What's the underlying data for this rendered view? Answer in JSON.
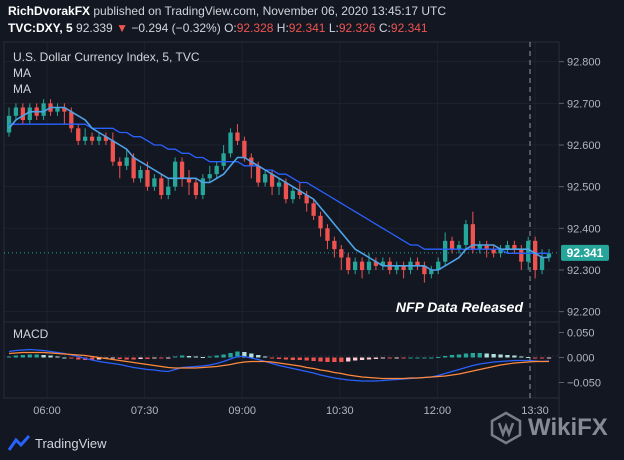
{
  "header": {
    "publisher": "RichDvorakFX",
    "published_text": "published on TradingView.com, November 06, 2020 13:45:17 UTC",
    "symbol": "TVC:DXY, 5",
    "price": "92.339",
    "change_arrow": "▼",
    "change": "−0.294 (−0.32%)",
    "o_label": "O:",
    "o_value": "92.328",
    "h_label": "H:",
    "h_value": "92.341",
    "l_label": "L:",
    "l_value": "92.326",
    "c_label": "C:",
    "c_value": "92.341"
  },
  "legend": {
    "series_title": "U.S. Dollar Currency Index, 5, TVC",
    "ma1": "MA",
    "ma2": "MA",
    "macd": "MACD"
  },
  "annotation": "NFP Data Released",
  "last_price_tag": "92.341",
  "branding": {
    "tradingview": "TradingView",
    "wikifx": "WikiFX"
  },
  "colors": {
    "background": "#131722",
    "up": "#26a69a",
    "down": "#ef5350",
    "ma_fast": "#4fa3e8",
    "ma_slow": "#2962ff",
    "macd_line": "#2962ff",
    "signal_line": "#ff8a3d",
    "price_tag": "#26a69a"
  },
  "chart_data": [
    {
      "type": "candlestick",
      "title": "U.S. Dollar Currency Index, 5, TVC",
      "x_ticks": [
        "06:00",
        "07:30",
        "09:00",
        "10:30",
        "12:00",
        "13:30"
      ],
      "y_ticks": [
        92.2,
        92.3,
        92.4,
        92.5,
        92.6,
        92.7,
        92.8
      ],
      "ylim": [
        92.18,
        92.84
      ],
      "candles": [
        [
          92.63,
          92.67,
          92.69,
          92.62
        ],
        [
          92.67,
          92.69,
          92.7,
          92.66
        ],
        [
          92.69,
          92.66,
          92.7,
          92.65
        ],
        [
          92.66,
          92.69,
          92.7,
          92.65
        ],
        [
          92.69,
          92.67,
          92.7,
          92.66
        ],
        [
          92.67,
          92.7,
          92.71,
          92.66
        ],
        [
          92.7,
          92.68,
          92.71,
          92.67
        ],
        [
          92.68,
          92.69,
          92.7,
          92.67
        ],
        [
          92.69,
          92.68,
          92.7,
          92.65
        ],
        [
          92.68,
          92.64,
          92.69,
          92.63
        ],
        [
          92.64,
          92.61,
          92.65,
          92.6
        ],
        [
          92.61,
          92.62,
          92.64,
          92.6
        ],
        [
          92.62,
          92.61,
          92.63,
          92.6
        ],
        [
          92.61,
          92.62,
          92.63,
          92.6
        ],
        [
          92.62,
          92.61,
          92.63,
          92.6
        ],
        [
          92.61,
          92.56,
          92.63,
          92.55
        ],
        [
          92.56,
          92.55,
          92.57,
          92.52
        ],
        [
          92.55,
          92.57,
          92.59,
          92.54
        ],
        [
          92.57,
          92.52,
          92.58,
          92.51
        ],
        [
          92.52,
          92.54,
          92.55,
          92.51
        ],
        [
          92.54,
          92.5,
          92.56,
          92.49
        ],
        [
          92.5,
          92.52,
          92.53,
          92.49
        ],
        [
          92.52,
          92.48,
          92.53,
          92.47
        ],
        [
          92.48,
          92.5,
          92.52,
          92.47
        ],
        [
          92.5,
          92.56,
          92.57,
          92.49
        ],
        [
          92.56,
          92.52,
          92.57,
          92.5
        ],
        [
          92.52,
          92.51,
          92.54,
          92.48
        ],
        [
          92.51,
          92.48,
          92.52,
          92.47
        ],
        [
          92.48,
          92.52,
          92.53,
          92.47
        ],
        [
          92.52,
          92.53,
          92.55,
          92.51
        ],
        [
          92.53,
          92.55,
          92.56,
          92.52
        ],
        [
          92.55,
          92.58,
          92.6,
          92.54
        ],
        [
          92.58,
          92.63,
          92.64,
          92.57
        ],
        [
          92.63,
          92.61,
          92.65,
          92.6
        ],
        [
          92.61,
          92.57,
          92.62,
          92.56
        ],
        [
          92.57,
          92.55,
          92.58,
          92.52
        ],
        [
          92.55,
          92.51,
          92.56,
          92.5
        ],
        [
          92.51,
          92.53,
          92.54,
          92.5
        ],
        [
          92.53,
          92.5,
          92.54,
          92.48
        ],
        [
          92.5,
          92.51,
          92.52,
          92.48
        ],
        [
          92.51,
          92.47,
          92.52,
          92.46
        ],
        [
          92.47,
          92.49,
          92.5,
          92.46
        ],
        [
          92.49,
          92.48,
          92.51,
          92.47
        ],
        [
          92.48,
          92.46,
          92.49,
          92.44
        ],
        [
          92.46,
          92.43,
          92.47,
          92.42
        ],
        [
          92.43,
          92.4,
          92.44,
          92.38
        ],
        [
          92.4,
          92.37,
          92.41,
          92.35
        ],
        [
          92.37,
          92.35,
          92.38,
          92.33
        ],
        [
          92.35,
          92.33,
          92.36,
          92.3
        ],
        [
          92.33,
          92.3,
          92.34,
          92.29
        ],
        [
          92.3,
          92.32,
          92.33,
          92.29
        ],
        [
          92.32,
          92.3,
          92.33,
          92.28
        ],
        [
          92.3,
          92.32,
          92.34,
          92.29
        ],
        [
          92.32,
          92.31,
          92.33,
          92.3
        ],
        [
          92.31,
          92.32,
          92.33,
          92.3
        ],
        [
          92.32,
          92.3,
          92.33,
          92.29
        ],
        [
          92.3,
          92.31,
          92.32,
          92.29
        ],
        [
          92.31,
          92.3,
          92.32,
          92.28
        ],
        [
          92.3,
          92.32,
          92.33,
          92.29
        ],
        [
          92.32,
          92.31,
          92.33,
          92.3
        ],
        [
          92.31,
          92.29,
          92.32,
          92.27
        ],
        [
          92.29,
          92.3,
          92.31,
          92.28
        ],
        [
          92.3,
          92.32,
          92.33,
          92.29
        ],
        [
          92.32,
          92.37,
          92.39,
          92.31
        ],
        [
          92.37,
          92.35,
          92.38,
          92.34
        ],
        [
          92.35,
          92.36,
          92.37,
          92.34
        ],
        [
          92.36,
          92.41,
          92.42,
          92.35
        ],
        [
          92.41,
          92.35,
          92.44,
          92.34
        ],
        [
          92.35,
          92.36,
          92.37,
          92.34
        ],
        [
          92.36,
          92.35,
          92.37,
          92.33
        ],
        [
          92.35,
          92.34,
          92.36,
          92.33
        ],
        [
          92.34,
          92.35,
          92.36,
          92.33
        ],
        [
          92.35,
          92.36,
          92.37,
          92.34
        ],
        [
          92.36,
          92.35,
          92.37,
          92.34
        ],
        [
          92.35,
          92.32,
          92.36,
          92.3
        ],
        [
          92.32,
          92.37,
          92.38,
          92.3
        ],
        [
          92.37,
          92.3,
          92.38,
          92.28
        ],
        [
          92.3,
          92.33,
          92.35,
          92.29
        ],
        [
          92.33,
          92.34,
          92.35,
          92.32
        ]
      ],
      "ma_fast": [
        92.64,
        92.66,
        92.67,
        92.68,
        92.68,
        92.68,
        92.69,
        92.69,
        92.69,
        92.68,
        92.67,
        92.66,
        92.64,
        92.63,
        92.62,
        92.61,
        92.6,
        92.59,
        92.57,
        92.56,
        92.55,
        92.54,
        92.53,
        92.52,
        92.52,
        92.52,
        92.52,
        92.52,
        92.51,
        92.51,
        92.52,
        92.53,
        92.55,
        92.57,
        92.57,
        92.56,
        92.55,
        92.54,
        92.53,
        92.52,
        92.51,
        92.5,
        92.49,
        92.48,
        92.47,
        92.45,
        92.43,
        92.41,
        92.39,
        92.37,
        92.35,
        92.34,
        92.33,
        92.32,
        92.31,
        92.31,
        92.31,
        92.31,
        92.31,
        92.31,
        92.31,
        92.3,
        92.3,
        92.31,
        92.32,
        92.33,
        92.35,
        92.36,
        92.36,
        92.36,
        92.36,
        92.35,
        92.35,
        92.35,
        92.35,
        92.35,
        92.34,
        92.33,
        92.33
      ],
      "ma_slow": [
        92.65,
        92.65,
        92.65,
        92.65,
        92.65,
        92.65,
        92.65,
        92.65,
        92.65,
        92.65,
        92.65,
        92.65,
        92.64,
        92.64,
        92.64,
        92.64,
        92.63,
        92.63,
        92.62,
        92.62,
        92.61,
        92.6,
        92.6,
        92.59,
        92.59,
        92.58,
        92.58,
        92.57,
        92.57,
        92.56,
        92.56,
        92.56,
        92.56,
        92.56,
        92.55,
        92.55,
        92.55,
        92.54,
        92.54,
        92.53,
        92.53,
        92.52,
        92.51,
        92.51,
        92.5,
        92.49,
        92.48,
        92.47,
        92.46,
        92.45,
        92.44,
        92.43,
        92.42,
        92.41,
        92.4,
        92.39,
        92.38,
        92.37,
        92.36,
        92.36,
        92.35,
        92.35,
        92.35,
        92.35,
        92.35,
        92.35,
        92.35,
        92.35,
        92.35,
        92.35,
        92.35,
        92.35,
        92.34,
        92.34,
        92.34,
        92.34,
        92.34,
        92.34,
        92.34
      ],
      "last_price": 92.341
    },
    {
      "type": "macd",
      "title": "MACD",
      "y_ticks": [
        0.05,
        0.0,
        -0.05
      ],
      "ylim": [
        -0.075,
        0.065
      ],
      "histogram": [
        0.002,
        0.004,
        0.005,
        0.006,
        0.006,
        0.005,
        0.004,
        0.002,
        0.0,
        -0.002,
        -0.004,
        -0.005,
        -0.005,
        -0.004,
        -0.003,
        -0.002,
        -0.003,
        -0.004,
        -0.004,
        -0.003,
        -0.003,
        -0.002,
        -0.002,
        -0.001,
        0.002,
        0.004,
        0.003,
        0.002,
        0.001,
        0.002,
        0.004,
        0.006,
        0.009,
        0.012,
        0.011,
        0.008,
        0.005,
        0.002,
        -0.001,
        -0.003,
        -0.004,
        -0.005,
        -0.005,
        -0.006,
        -0.007,
        -0.008,
        -0.009,
        -0.009,
        -0.009,
        -0.008,
        -0.006,
        -0.005,
        -0.004,
        -0.003,
        -0.002,
        -0.002,
        -0.001,
        -0.001,
        0.0,
        0.0,
        0.0,
        0.0,
        0.001,
        0.003,
        0.005,
        0.006,
        0.008,
        0.009,
        0.009,
        0.008,
        0.007,
        0.006,
        0.005,
        0.004,
        0.002,
        0.001,
        -0.001,
        -0.002,
        -0.001
      ],
      "macd": [
        0.012,
        0.014,
        0.015,
        0.016,
        0.015,
        0.014,
        0.012,
        0.01,
        0.008,
        0.005,
        0.002,
        -0.002,
        -0.005,
        -0.008,
        -0.01,
        -0.012,
        -0.014,
        -0.017,
        -0.02,
        -0.022,
        -0.024,
        -0.025,
        -0.027,
        -0.028,
        -0.024,
        -0.02,
        -0.019,
        -0.018,
        -0.017,
        -0.015,
        -0.012,
        -0.008,
        -0.003,
        0.002,
        0.002,
        -0.001,
        -0.004,
        -0.008,
        -0.012,
        -0.016,
        -0.019,
        -0.022,
        -0.025,
        -0.028,
        -0.031,
        -0.035,
        -0.038,
        -0.041,
        -0.043,
        -0.045,
        -0.046,
        -0.047,
        -0.047,
        -0.047,
        -0.046,
        -0.045,
        -0.044,
        -0.043,
        -0.042,
        -0.041,
        -0.04,
        -0.039,
        -0.036,
        -0.032,
        -0.028,
        -0.024,
        -0.02,
        -0.016,
        -0.013,
        -0.011,
        -0.009,
        -0.008,
        -0.007,
        -0.006,
        -0.006,
        -0.006,
        -0.007,
        -0.008,
        -0.007
      ],
      "signal": [
        0.008,
        0.009,
        0.01,
        0.01,
        0.01,
        0.01,
        0.009,
        0.008,
        0.007,
        0.006,
        0.005,
        0.004,
        0.002,
        0.0,
        -0.002,
        -0.004,
        -0.006,
        -0.008,
        -0.01,
        -0.012,
        -0.014,
        -0.016,
        -0.018,
        -0.02,
        -0.021,
        -0.021,
        -0.021,
        -0.021,
        -0.02,
        -0.019,
        -0.018,
        -0.016,
        -0.014,
        -0.011,
        -0.009,
        -0.008,
        -0.008,
        -0.008,
        -0.009,
        -0.011,
        -0.013,
        -0.015,
        -0.017,
        -0.02,
        -0.022,
        -0.025,
        -0.027,
        -0.03,
        -0.032,
        -0.035,
        -0.037,
        -0.039,
        -0.04,
        -0.041,
        -0.042,
        -0.042,
        -0.042,
        -0.042,
        -0.041,
        -0.041,
        -0.04,
        -0.039,
        -0.038,
        -0.037,
        -0.035,
        -0.033,
        -0.03,
        -0.027,
        -0.024,
        -0.021,
        -0.018,
        -0.015,
        -0.013,
        -0.011,
        -0.01,
        -0.009,
        -0.008,
        -0.008,
        -0.008
      ]
    }
  ]
}
